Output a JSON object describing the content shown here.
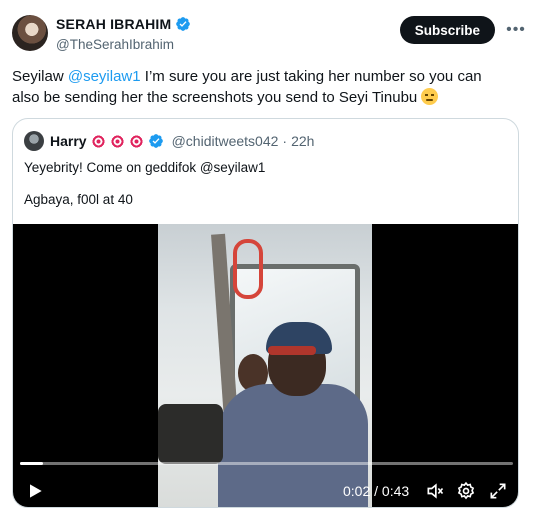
{
  "author": {
    "display_name": "SERAH IBRAHIM",
    "handle": "@TheSerahIbrahim",
    "verified": true,
    "avatar_icon": "profile-photo"
  },
  "actions": {
    "subscribe_label": "Subscribe",
    "more_icon": "more-horizontal-icon"
  },
  "tweet": {
    "text_before": "Seyilaw ",
    "mention": "@seyilaw1",
    "text_after": " I’m sure you are just taking her number so you can also be sending her the screenshots you send to Seyi Tinubu ",
    "emoji": "unamused-face"
  },
  "quote": {
    "display_name": "Harry",
    "name_emojis": [
      "direct-hit",
      "direct-hit",
      "direct-hit"
    ],
    "verified": true,
    "handle": "@chiditweets042",
    "separator": "·",
    "time": "22h",
    "line1": "Yeyebrity! Come on geddifok @seyilaw1",
    "line2": "Agbaya, f00l at 40"
  },
  "video": {
    "time_display": "0:02 / 0:43",
    "progress": 0.047,
    "controls": [
      "play-icon",
      "mute-icon",
      "settings-icon",
      "fullscreen-icon"
    ]
  },
  "colors": {
    "accent": "#1d9bf0",
    "text": "#0f1419",
    "secondary_text": "#536471",
    "border": "#cfd9de"
  }
}
